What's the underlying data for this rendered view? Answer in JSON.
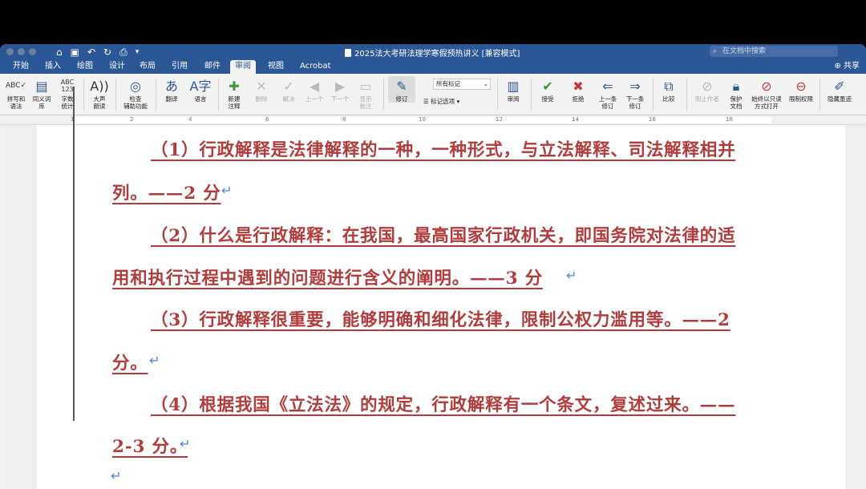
{
  "app": {
    "doc_title": "2025法大考研法理学寒假预热讲义 [兼容模式]",
    "search_placeholder": "在文档中搜索",
    "share_label": "共享"
  },
  "tabs": [
    {
      "label": "开始"
    },
    {
      "label": "插入"
    },
    {
      "label": "绘图"
    },
    {
      "label": "设计"
    },
    {
      "label": "布局"
    },
    {
      "label": "引用"
    },
    {
      "label": "邮件"
    },
    {
      "label": "审阅",
      "active": true
    },
    {
      "label": "视图"
    },
    {
      "label": "Acrobat"
    }
  ],
  "ribbon": {
    "spelling": {
      "l1": "拼写和",
      "l2": "语法"
    },
    "thesaurus": {
      "l1": "同义词",
      "l2": "库"
    },
    "wordcount": {
      "l1": "字数",
      "l2": "统计"
    },
    "readaloud": {
      "l1": "大声",
      "l2": "朗读"
    },
    "accessibility": {
      "l1": "检查",
      "l2": "辅助功能"
    },
    "translate": {
      "l1": "翻译"
    },
    "language": {
      "l1": "语言"
    },
    "newcomment": {
      "l1": "新建",
      "l2": "注释"
    },
    "delete": {
      "l1": "删除"
    },
    "resolve": {
      "l1": "解决"
    },
    "prev": {
      "l1": "上一个"
    },
    "next": {
      "l1": "下一个"
    },
    "showcomments": {
      "l1": "显示",
      "l2": "批注"
    },
    "track": {
      "l1": "修订"
    },
    "markup_select": "所有标记",
    "markup_options": "标记选项",
    "review": {
      "l1": "审阅"
    },
    "accept": {
      "l1": "接受"
    },
    "reject": {
      "l1": "拒绝"
    },
    "prevchange": {
      "l1": "上一条",
      "l2": "修订"
    },
    "nextchange": {
      "l1": "下一条",
      "l2": "修订"
    },
    "compare": {
      "l1": "比较"
    },
    "blockauthors": {
      "l1": "阻止作者"
    },
    "protect": {
      "l1": "保护",
      "l2": "文档"
    },
    "alwaysreadonly": {
      "l1": "始终以只读",
      "l2": "方式打开"
    },
    "restrict": {
      "l1": "限制权限"
    },
    "hideink": {
      "l1": "隐藏墨迹"
    }
  },
  "ruler": [
    "1",
    "2",
    "4",
    "6",
    "8",
    "10",
    "12",
    "14",
    "16",
    "18"
  ],
  "document": {
    "lines": [
      "（1）行政解释是法律解释的一种，一种形式，与立法解释、司法解释相并",
      "列。——2 分",
      "（2）什么是行政解释：在我国，最高国家行政机关，即国务院对法律的适",
      "用和执行过程中遇到的问题进行含义的阐明。——3 分",
      "（3）行政解释很重要，能够明确和细化法律，限制公权力滥用等。——2",
      "分。",
      "（4）根据我国《立法法》的规定，行政解释有一个条文，复述过来。——",
      "2-3 分。"
    ],
    "paragraph_mark": "↵"
  }
}
